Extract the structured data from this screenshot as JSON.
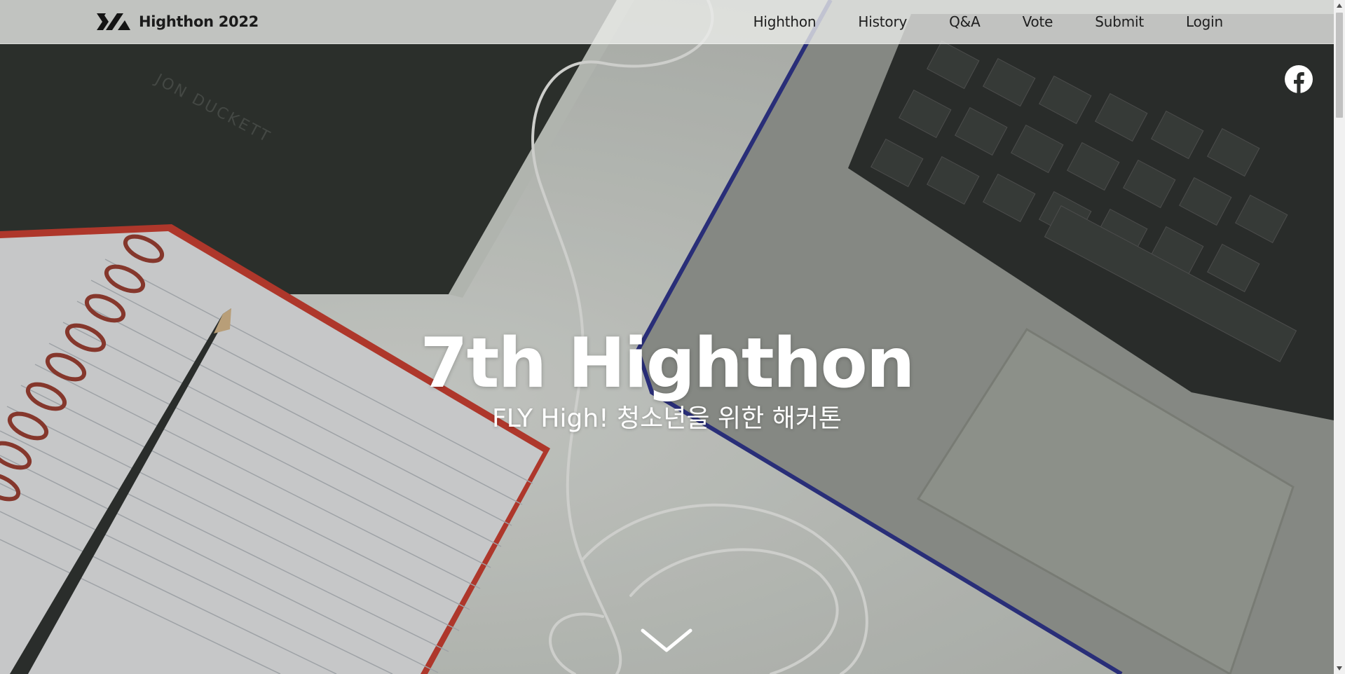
{
  "brand": {
    "name": "Highthon 2022",
    "logo_icon": "highthon-logo-icon"
  },
  "nav": {
    "items": [
      {
        "label": "Highthon"
      },
      {
        "label": "History"
      },
      {
        "label": "Q&A"
      },
      {
        "label": "Vote"
      },
      {
        "label": "Submit"
      },
      {
        "label": "Login"
      }
    ]
  },
  "social": {
    "facebook_icon": "facebook-icon"
  },
  "hero": {
    "title": "7th Highthon",
    "subtitle": "FLY High! 청소년을 위한 해커톤",
    "background_description_icon": "desk-photo",
    "scroll_icon": "chevron-down-icon"
  },
  "colors": {
    "nav_bg": "#ecedeb",
    "nav_text": "#1e1e1e",
    "hero_text": "#ffffff"
  }
}
